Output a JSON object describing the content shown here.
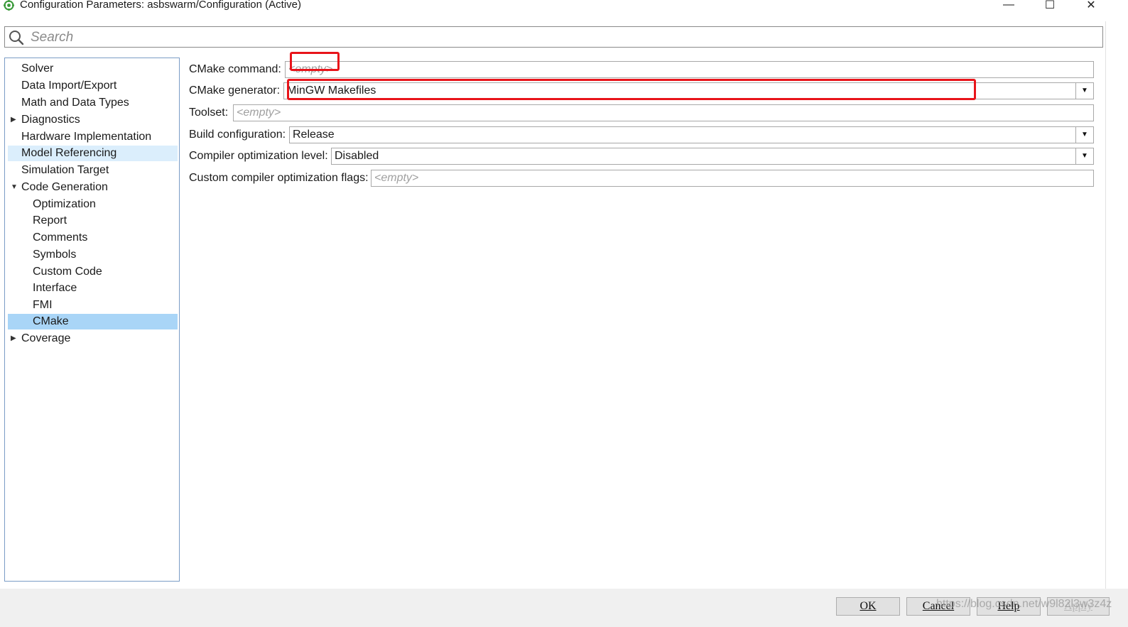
{
  "window": {
    "title": "Configuration Parameters: asbswarm/Configuration (Active)",
    "minimize_glyph": "—",
    "maximize_glyph": "☐",
    "close_glyph": "✕"
  },
  "search": {
    "placeholder": "Search",
    "icon": "search-icon"
  },
  "tree": {
    "items": [
      {
        "label": "Solver",
        "level": 0,
        "expander": "none"
      },
      {
        "label": "Data Import/Export",
        "level": 0,
        "expander": "none"
      },
      {
        "label": "Math and Data Types",
        "level": 0,
        "expander": "none"
      },
      {
        "label": "Diagnostics",
        "level": 0,
        "expander": "collapsed"
      },
      {
        "label": "Hardware Implementation",
        "level": 0,
        "expander": "none"
      },
      {
        "label": "Model Referencing",
        "level": 0,
        "expander": "none",
        "state": "hover"
      },
      {
        "label": "Simulation Target",
        "level": 0,
        "expander": "none"
      },
      {
        "label": "Code Generation",
        "level": 0,
        "expander": "expanded"
      },
      {
        "label": "Optimization",
        "level": 1,
        "expander": "none"
      },
      {
        "label": "Report",
        "level": 1,
        "expander": "none"
      },
      {
        "label": "Comments",
        "level": 1,
        "expander": "none"
      },
      {
        "label": "Symbols",
        "level": 1,
        "expander": "none"
      },
      {
        "label": "Custom Code",
        "level": 1,
        "expander": "none"
      },
      {
        "label": "Interface",
        "level": 1,
        "expander": "none"
      },
      {
        "label": "FMI",
        "level": 1,
        "expander": "none"
      },
      {
        "label": "CMake",
        "level": 1,
        "expander": "none",
        "state": "selected"
      },
      {
        "label": "Coverage",
        "level": 0,
        "expander": "collapsed"
      }
    ],
    "arrow_collapsed": "▶",
    "arrow_expanded": "▼"
  },
  "settings": {
    "cmake_command": {
      "label": "CMake command:",
      "value": "",
      "placeholder": "<empty>"
    },
    "cmake_generator": {
      "label": "CMake generator:",
      "value": "MinGW Makefiles"
    },
    "toolset": {
      "label": "Toolset:",
      "value": "",
      "placeholder": "<empty>"
    },
    "build_configuration": {
      "label": "Build configuration:",
      "value": "Release"
    },
    "compiler_optimization_level": {
      "label": "Compiler optimization level:",
      "value": "Disabled"
    },
    "custom_compiler_optimization_flags": {
      "label": "Custom compiler optimization flags:",
      "value": "",
      "placeholder": "<empty>"
    },
    "dropdown_glyph": "▼"
  },
  "footer": {
    "ok": "OK",
    "cancel": "Cancel",
    "help": "Help",
    "apply": "Apply"
  },
  "watermark": "https://blog.csdn.net/w9l82l3w3z4z",
  "colors": {
    "selected": "#a9d5f7",
    "hover": "#dbeefc",
    "annotation": "#e8141a"
  }
}
